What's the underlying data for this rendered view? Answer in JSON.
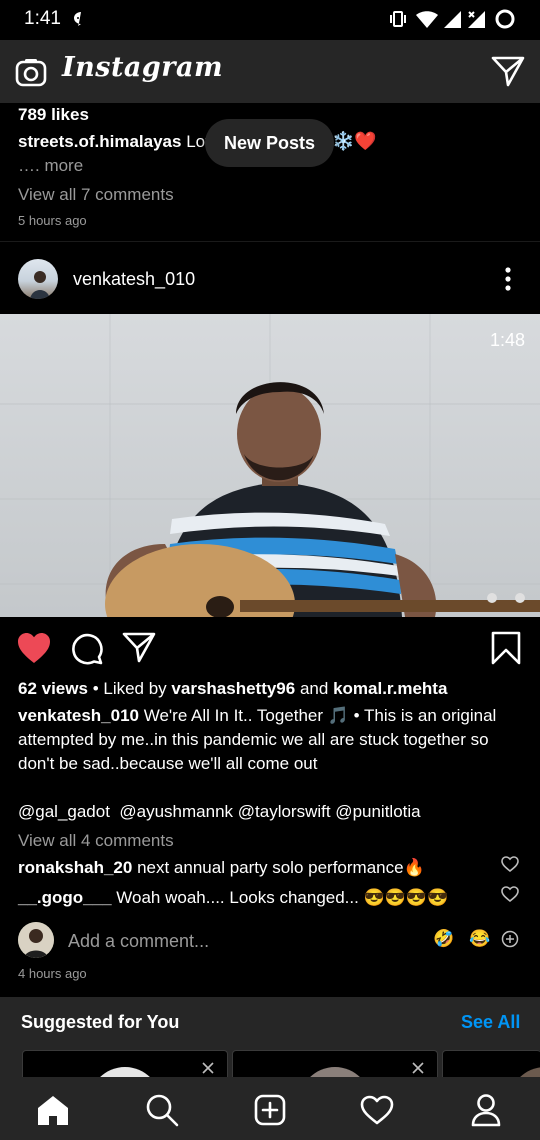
{
  "status_bar": {
    "time": "1:41"
  },
  "app": {
    "brand": "Instagram"
  },
  "prev_post": {
    "likes": "789 likes",
    "caption_user": "streets.of.himalayas",
    "caption_text": "Lov",
    "more": "…. more",
    "view_comments": "View all 7 comments",
    "time_ago": "5 hours ago"
  },
  "new_posts_pill": "New Posts",
  "post": {
    "username": "venkatesh_010",
    "video_duration": "1:48",
    "views": "62 views",
    "liked_by_prefix": "• Liked by",
    "liked_by_user1": "varshashetty96",
    "liked_and": "and",
    "liked_by_user2": "komal.r.mehta",
    "caption_user": "venkatesh_010",
    "caption_line1": "We're All In It.. Together 🎵 • This is an original",
    "caption_line2": "attempted by me..in this pandemic we all are stuck together so",
    "caption_line3": "don't be sad..because we'll all come out",
    "mentions": "@gal_gadot  @ayushmannk @taylorswift @punitlotia",
    "view_comments": "View all 4 comments",
    "comments": [
      {
        "user": "ronakshah_20",
        "text": "next annual party solo performance🔥"
      },
      {
        "user": "__.gogo___",
        "text": "Woah woah.... Looks changed... 😎😎😎😎"
      }
    ],
    "add_comment_placeholder": "Add a comment...",
    "quick_emojis": [
      "🤣",
      "😂"
    ],
    "time_ago": "4 hours ago"
  },
  "suggested": {
    "title": "Suggested for You",
    "see_all": "See All"
  },
  "colors": {
    "like_red": "#ed4956",
    "link_blue": "#0095f6",
    "panel": "#262626"
  }
}
